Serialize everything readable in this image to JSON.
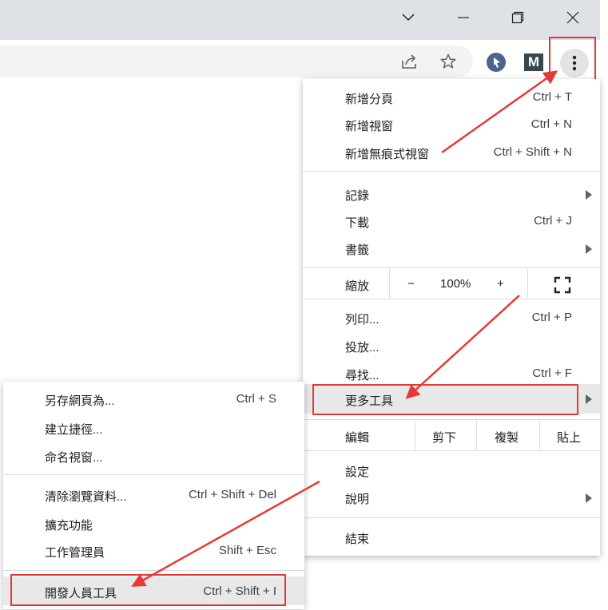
{
  "window_controls": {
    "tab_search": "tab-search",
    "minimize": "minimize",
    "restore": "restore",
    "close": "close"
  },
  "toolbar": {
    "share_icon": "share-icon",
    "bookmark_icon": "star-icon",
    "extension1_icon": "cursor-extension-icon",
    "extension2_letter": "M",
    "menu_icon": "kebab-icon"
  },
  "main_menu": {
    "items": [
      {
        "label": "新增分頁",
        "shortcut": "Ctrl + T"
      },
      {
        "label": "新增視窗",
        "shortcut": "Ctrl + N"
      },
      {
        "label": "新增無痕式視窗",
        "shortcut": "Ctrl + Shift + N"
      },
      {
        "label": "記錄",
        "shortcut": ""
      },
      {
        "label": "下載",
        "shortcut": "Ctrl + J"
      },
      {
        "label": "書籤",
        "shortcut": ""
      }
    ],
    "zoom": {
      "label": "縮放",
      "minus": "−",
      "value": "100%",
      "plus": "+"
    },
    "items2": [
      {
        "label": "列印...",
        "shortcut": "Ctrl + P"
      },
      {
        "label": "投放...",
        "shortcut": ""
      },
      {
        "label": "尋找...",
        "shortcut": "Ctrl + F"
      },
      {
        "label": "更多工具",
        "shortcut": ""
      }
    ],
    "edit": {
      "label": "編輯",
      "cut": "剪下",
      "copy": "複製",
      "paste": "貼上"
    },
    "settings": "設定",
    "help": "說明",
    "exit": "結束"
  },
  "more_tools_menu": {
    "items": [
      {
        "label": "另存網頁為...",
        "shortcut": "Ctrl + S"
      },
      {
        "label": "建立捷徑...",
        "shortcut": ""
      },
      {
        "label": "命名視窗...",
        "shortcut": ""
      },
      {
        "label": "清除瀏覽資料...",
        "shortcut": "Ctrl + Shift + Del"
      },
      {
        "label": "擴充功能",
        "shortcut": ""
      },
      {
        "label": "工作管理員",
        "shortcut": "Shift + Esc"
      },
      {
        "label": "開發人員工具",
        "shortcut": "Ctrl + Shift + I"
      }
    ]
  },
  "colors": {
    "highlight": "#e53935",
    "menu_hover": "#e8e8e8",
    "titlebar": "#dee1e6"
  }
}
